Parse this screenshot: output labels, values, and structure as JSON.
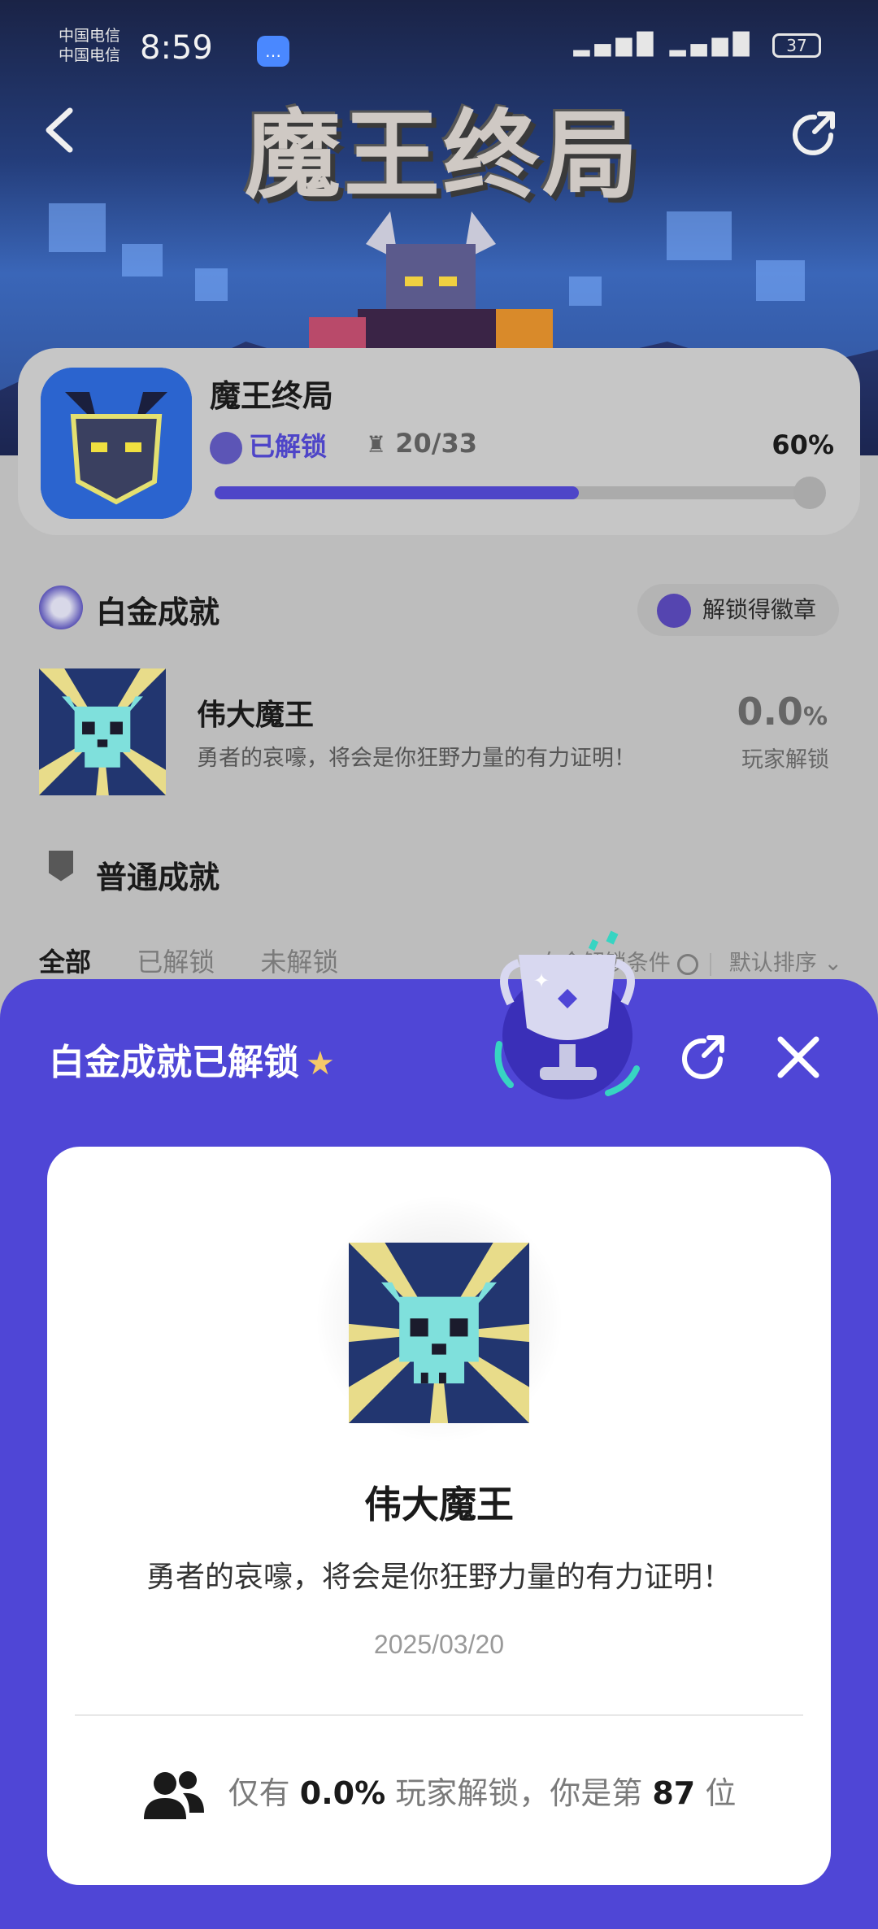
{
  "status_bar": {
    "carrier_1": "中国电信",
    "carrier_2": "中国电信",
    "time": "8:59",
    "battery": "37"
  },
  "banner": {
    "logo_text": "魔王终局"
  },
  "game": {
    "title": "魔王终局",
    "unlocked_label": "已解锁",
    "trophy_count": "20/33",
    "percent": "60%",
    "progress": 0.6
  },
  "platinum": {
    "section_title": "白金成就",
    "badge_button": "解锁得徽章",
    "achievement": {
      "name": "伟大魔王",
      "description": "勇者的哀嚎，将会是你狂野力量的有力证明！",
      "percent_value": "0.0",
      "percent_sign": "%",
      "percent_label": "玩家解锁"
    }
  },
  "normal": {
    "section_title": "普通成就",
    "tabs": [
      "全部",
      "已解锁",
      "未解锁"
    ],
    "filter_condition": "白金解锁条件",
    "sort": "默认排序"
  },
  "sheet": {
    "title": "白金成就已解锁",
    "card": {
      "name": "伟大魔王",
      "description": "勇者的哀嚎，将会是你狂野力量的有力证明！",
      "date": "2025/03/20",
      "foot_prefix": "仅有",
      "foot_percent": "0.0%",
      "foot_middle": "玩家解锁，你是第",
      "foot_rank": "87",
      "foot_suffix": "位"
    }
  },
  "colors": {
    "accent": "#4f46d6",
    "progress_fill": "#4e45c8",
    "sheet_bg": "#4f46d6"
  },
  "icons": [
    "back-arrow-icon",
    "share-icon",
    "close-icon",
    "trophy-icon",
    "people-icon",
    "star-icon",
    "chevron-down-icon",
    "info-circle-icon"
  ]
}
